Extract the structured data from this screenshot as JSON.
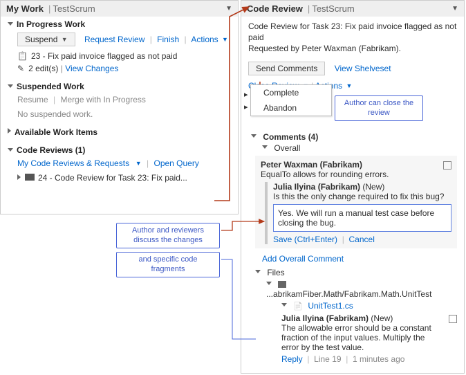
{
  "left": {
    "title": "My Work",
    "context": "TestScrum",
    "inProgress": {
      "header": "In Progress Work",
      "suspend": "Suspend",
      "requestReview": "Request Review",
      "finish": "Finish",
      "actions": "Actions",
      "itemText": "23 - Fix paid invoice flagged as not paid",
      "editsText": "2 edit(s)",
      "viewChanges": "View Changes"
    },
    "suspended": {
      "header": "Suspended Work",
      "resume": "Resume",
      "merge": "Merge with In Progress",
      "empty": "No suspended work."
    },
    "available": {
      "header": "Available Work Items"
    },
    "codeReviews": {
      "header": "Code Reviews (1)",
      "myReviews": "My Code Reviews & Requests",
      "openQuery": "Open Query",
      "item": "24 - Code Review for Task 23: Fix paid..."
    }
  },
  "right": {
    "title": "Code Review",
    "context": "TestScrum",
    "descLine1": "Code Review for Task 23: Fix paid invoice flagged as not paid",
    "descLine2": "Requested by Peter Waxman (Fabrikam).",
    "sendComments": "Send Comments",
    "viewShelveset": "View Shelveset",
    "closeReview": "Close Review",
    "actions": "Actions",
    "menu": {
      "complete": "Complete",
      "abandon": "Abandon"
    },
    "commentsHeader": "Comments (4)",
    "overall": "Overall",
    "c1": {
      "author": "Peter Waxman (Fabrikam)",
      "text": "EqualTo allows for rounding errors."
    },
    "c2": {
      "author": "Julia Ilyina (Fabrikam)",
      "badge": "(New)",
      "text": "Is this the only change required to fix this bug?"
    },
    "replyText": "Yes. We will run a manual test case before closing the bug.",
    "save": "Save (Ctrl+Enter)",
    "cancel": "Cancel",
    "addOverall": "Add Overall Comment",
    "filesHeader": "Files",
    "filePath": "...abrikamFiber.Math/Fabrikam.Math.UnitTest",
    "fileName": "UnitTest1.cs",
    "c3": {
      "author": "Julia Ilyina (Fabrikam)",
      "badge": "(New)",
      "text": "The allowable error should be a constant fraction of the input values. Multiply the error by the test value."
    },
    "replyLink": "Reply",
    "lineRef": "Line 19",
    "timeAgo": "1 minutes ago"
  },
  "callouts": {
    "close": "Author can close the review",
    "discuss": "Author and reviewers discuss the changes",
    "fragments": "and specific code fragments"
  }
}
